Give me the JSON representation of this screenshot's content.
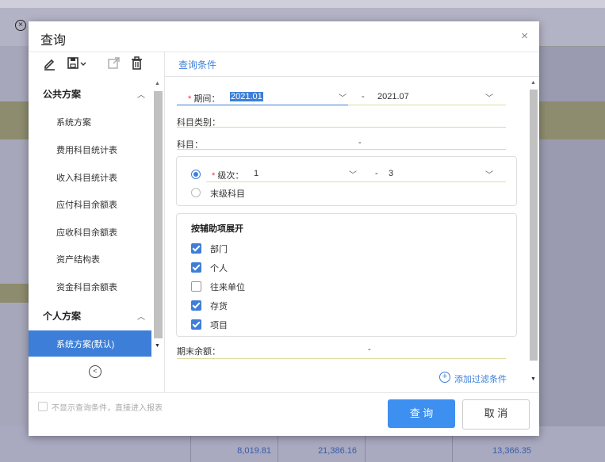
{
  "dialog": {
    "title": "查询",
    "close_icon": "×"
  },
  "left": {
    "public_section": "公共方案",
    "public_items": [
      "系统方案",
      "费用科目统计表",
      "收入科目统计表",
      "应付科目余额表",
      "应收科目余额表",
      "资产结构表",
      "资金科目余额表"
    ],
    "personal_section": "个人方案",
    "personal_selected": "系统方案(默认)"
  },
  "right": {
    "tab": "查询条件",
    "period_label": "期间：",
    "period_from": "2021.01",
    "period_sep": "-",
    "period_to": "2021.07",
    "category_label": "科目类别：",
    "subject_label": "科目：",
    "subject_sep": "-",
    "level_label": "级次：",
    "level_from": "1",
    "level_sep": "-",
    "level_to": "3",
    "last_level_label": "末级科目",
    "aux_title": "按辅助项展开",
    "aux_items": [
      {
        "label": "部门",
        "checked": true
      },
      {
        "label": "个人",
        "checked": true
      },
      {
        "label": "往来单位",
        "checked": false
      },
      {
        "label": "存货",
        "checked": true
      },
      {
        "label": "项目",
        "checked": true
      }
    ],
    "balance_label": "期末余额：",
    "balance_sep": "-",
    "add_filter": "添加过滤条件"
  },
  "footer": {
    "skip_label": "不显示查询条件，直接进入报表",
    "query_button": "查 询",
    "cancel_button": "取 消"
  },
  "background": {
    "row_values": [
      "8,019.81",
      "21,386.16",
      "13,366.35"
    ]
  },
  "colors": {
    "accent": "#3d7fd8",
    "primary_button": "#3d8ff0",
    "required": "#ee3344"
  }
}
